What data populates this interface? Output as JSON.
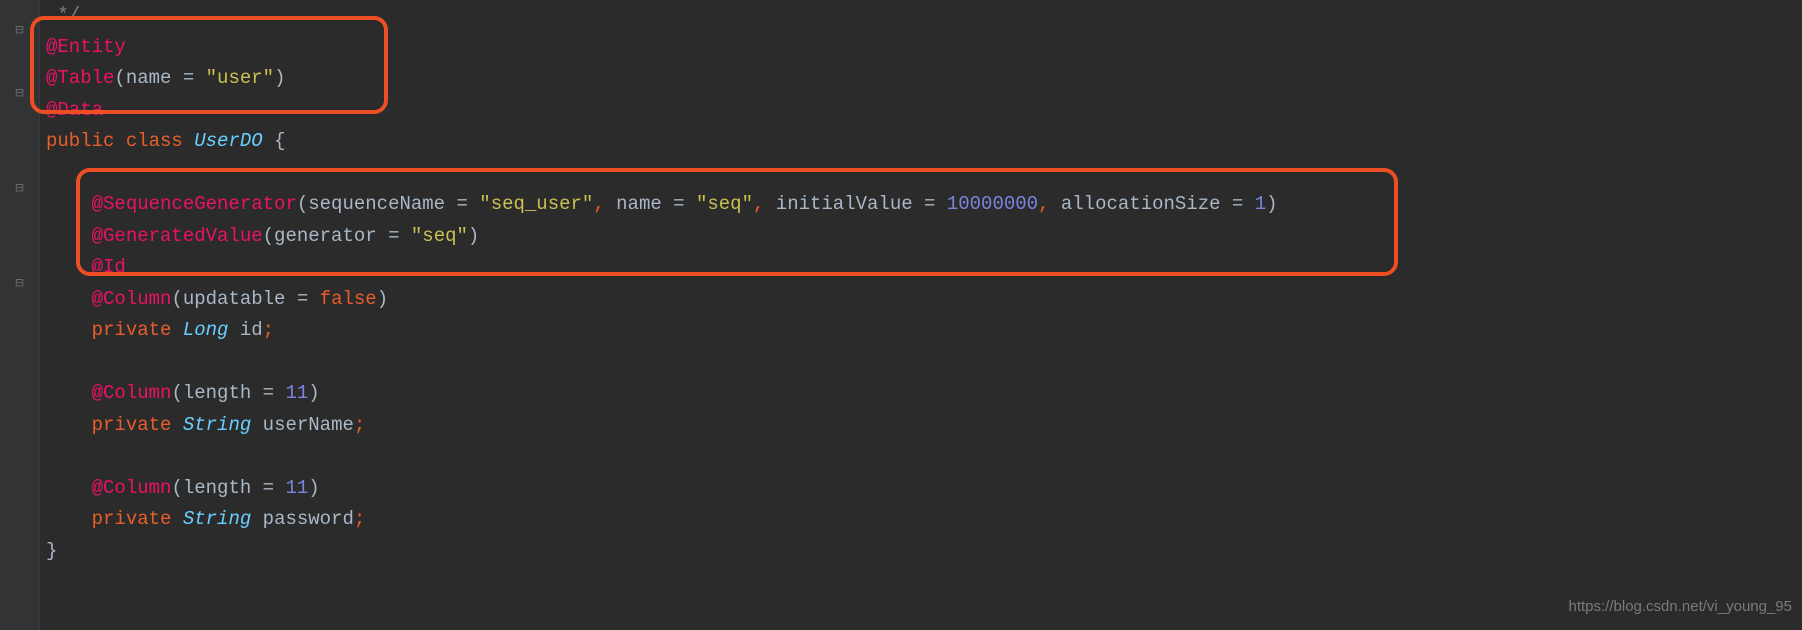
{
  "code": {
    "line0_comment": " */",
    "entity": "@Entity",
    "table_anno": "@Table",
    "table_name_param": "name",
    "table_name_val": "\"user\"",
    "data_anno": "@Data",
    "kw_public": "public",
    "kw_class": "class",
    "classname": "UserDO",
    "brace_open": "{",
    "seqgen": "@SequenceGenerator",
    "seq_seqname_param": "sequenceName",
    "seq_seqname_val": "\"seq_user\"",
    "seq_name_param": "name",
    "seq_name_val": "\"seq\"",
    "seq_init_param": "initialValue",
    "seq_init_val": "10000000",
    "seq_alloc_param": "allocationSize",
    "seq_alloc_val": "1",
    "genval": "@GeneratedValue",
    "genval_param": "generator",
    "genval_val": "\"seq\"",
    "id_anno": "@Id",
    "col_anno1": "@Column",
    "col_updatable_param": "updatable",
    "col_false": "false",
    "kw_private": "private",
    "type_long": "Long",
    "fld_id": "id",
    "col_anno2": "@Column",
    "col_length_param": "length",
    "col_length_val": "11",
    "type_string": "String",
    "fld_username": "userName",
    "col_anno3": "@Column",
    "fld_password": "password",
    "brace_close": "}"
  },
  "watermark": "https://blog.csdn.net/vi_young_95"
}
